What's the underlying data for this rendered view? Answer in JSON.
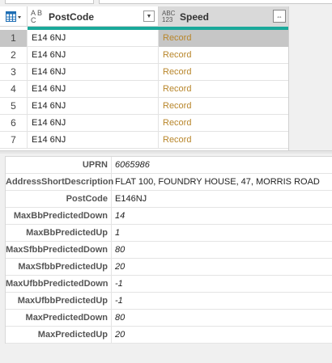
{
  "grid": {
    "columns": [
      {
        "type_icon": "A B C",
        "name": "PostCode"
      },
      {
        "type_icon_top": "ABC",
        "type_icon_bottom": "123",
        "name": "Speed"
      }
    ],
    "rows": [
      {
        "num": "1",
        "postcode": "E14 6NJ",
        "speed": "Record"
      },
      {
        "num": "2",
        "postcode": "E14 6NJ",
        "speed": "Record"
      },
      {
        "num": "3",
        "postcode": "E14 6NJ",
        "speed": "Record"
      },
      {
        "num": "4",
        "postcode": "E14 6NJ",
        "speed": "Record"
      },
      {
        "num": "5",
        "postcode": "E14 6NJ",
        "speed": "Record"
      },
      {
        "num": "6",
        "postcode": "E14 6NJ",
        "speed": "Record"
      },
      {
        "num": "7",
        "postcode": "E14 6NJ",
        "speed": "Record"
      }
    ]
  },
  "record": [
    {
      "key": "UPRN",
      "value": "6065986"
    },
    {
      "key": "AddressShortDescription",
      "value": "FLAT 100, FOUNDRY HOUSE, 47, MORRIS ROAD"
    },
    {
      "key": "PostCode",
      "value": "E146NJ"
    },
    {
      "key": "MaxBbPredictedDown",
      "value": "14"
    },
    {
      "key": "MaxBbPredictedUp",
      "value": "1"
    },
    {
      "key": "MaxSfbbPredictedDown",
      "value": "80"
    },
    {
      "key": "MaxSfbbPredictedUp",
      "value": "20"
    },
    {
      "key": "MaxUfbbPredictedDown",
      "value": "-1"
    },
    {
      "key": "MaxUfbbPredictedUp",
      "value": "-1"
    },
    {
      "key": "MaxPredictedDown",
      "value": "80"
    },
    {
      "key": "MaxPredictedUp",
      "value": "20"
    }
  ],
  "colors": {
    "quality_bar": "#1aa99a",
    "record_link": "#b8862b",
    "selected": "#c6c6c6"
  }
}
